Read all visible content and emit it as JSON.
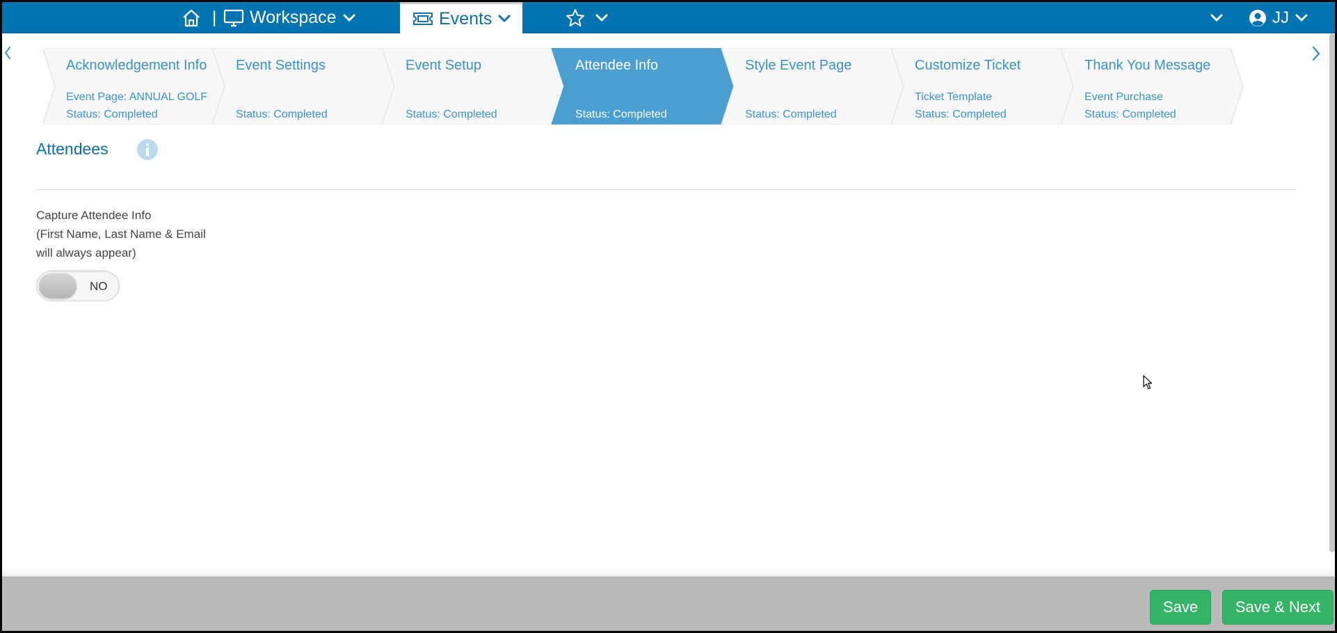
{
  "nav": {
    "workspace_label": "Workspace",
    "separator": "|",
    "events_label": "Events",
    "user_initials": "JJ"
  },
  "stepper": {
    "steps": [
      {
        "title": "Acknowledgement Info",
        "subtitle": "Event Page: ANNUAL GOLF",
        "status": "Status: Completed",
        "active": false
      },
      {
        "title": "Event Settings",
        "subtitle": "",
        "status": "Status: Completed",
        "active": false
      },
      {
        "title": "Event Setup",
        "subtitle": "",
        "status": "Status: Completed",
        "active": false
      },
      {
        "title": "Attendee Info",
        "subtitle": "",
        "status": "Status: Completed",
        "active": true
      },
      {
        "title": "Style Event Page",
        "subtitle": "",
        "status": "Status: Completed",
        "active": false
      },
      {
        "title": "Customize Ticket",
        "subtitle": "Ticket Template",
        "status": "Status: Completed",
        "active": false
      },
      {
        "title": "Thank You Message",
        "subtitle": "Event Purchase",
        "status": "Status: Completed",
        "active": false
      }
    ]
  },
  "content": {
    "section_title": "Attendees",
    "capture_line1": "Capture Attendee Info",
    "capture_line2": "(First Name, Last Name & Email",
    "capture_line3": "will always appear)",
    "toggle_label": "NO",
    "toggle_on": false
  },
  "footer": {
    "save_label": "Save",
    "save_next_label": "Save & Next"
  },
  "colors": {
    "nav_bg": "#0073b1",
    "active_step": "#4a9fd0",
    "step_text": "#3a93c6",
    "title_text": "#0d6ea8",
    "button_green": "#33b566",
    "footer_bg": "#bababa"
  },
  "icons": {
    "home": "home-icon",
    "workspace": "monitor-icon",
    "events": "ticket-icon",
    "favorites": "star-icon",
    "user": "user-circle-icon",
    "info": "info-icon"
  }
}
